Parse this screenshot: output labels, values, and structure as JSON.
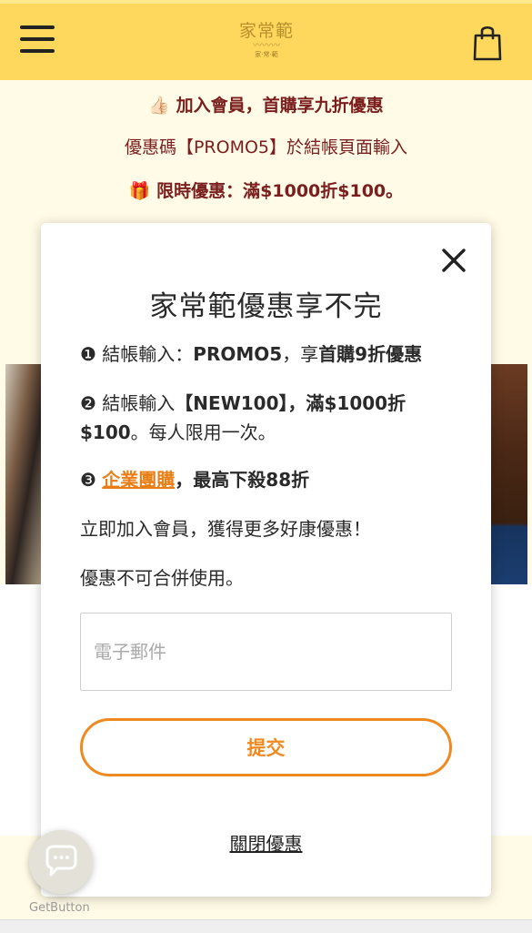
{
  "header": {
    "logo_text": "家常範",
    "logo_sub": "家·常·範",
    "menu_icon": "hamburger-icon",
    "cart_icon": "shopping-bag-icon",
    "header_color": "#fdd85d"
  },
  "promo": {
    "line1_emoji": "👍🏻",
    "line1": "加入會員，首購享九折優惠",
    "line2": "優惠碼【PROMO5】於結帳頁面輸入",
    "line3_emoji": "🎁",
    "line3": "限時優惠：滿$1000折$100。",
    "text_color": "#7a1e1e"
  },
  "modal": {
    "title": "家常範優惠享不完",
    "item1": {
      "bullet": "❶",
      "text_a": " 結帳輸入：",
      "text_b": "PROMO5",
      "text_c": "，享",
      "text_d": "首購9折優惠"
    },
    "item2": {
      "bullet": "❷",
      "text_a": " 結帳輸入",
      "text_b": "【NEW100】，滿$1000折$100",
      "text_c": "。每人限用一次。"
    },
    "item3": {
      "bullet": "❸",
      "link": "企業團購",
      "text_b": "，最高下殺88折"
    },
    "line4": "立即加入會員，獲得更多好康優惠！",
    "line5": "優惠不可合併使用。",
    "email_placeholder": "電子郵件",
    "email_value": "",
    "submit_label": "提交",
    "close_offer_label": "關閉優惠",
    "accent_color": "#ee8a1f"
  },
  "widget": {
    "chat_icon": "chat-bubble-icon",
    "label": "GetButton"
  }
}
